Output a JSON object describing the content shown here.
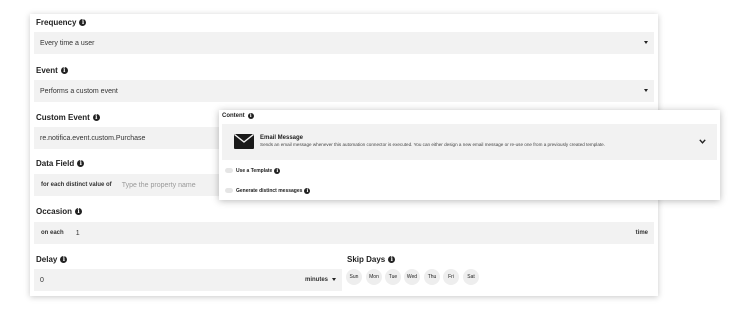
{
  "form": {
    "frequency": {
      "label": "Frequency",
      "value": "Every time a user"
    },
    "event": {
      "label": "Event",
      "value": "Performs a custom event"
    },
    "custom_event": {
      "label": "Custom Event",
      "value": "re.notifica.event.custom.Purchase"
    },
    "data_field": {
      "label": "Data Field",
      "prefix": "for each distinct value of",
      "placeholder": "Type the property name"
    },
    "occasion": {
      "label": "Occasion",
      "prefix": "on each",
      "value": "1",
      "suffix": "time"
    },
    "delay": {
      "label": "Delay",
      "value": "0",
      "unit": "minutes"
    },
    "skip_days": {
      "label": "Skip Days",
      "days": [
        "Sun",
        "Mon",
        "Tue",
        "Wed",
        "Thu",
        "Fri",
        "Sat"
      ]
    }
  },
  "content_popup": {
    "label": "Content",
    "email": {
      "title": "Email Message",
      "description": "Sends an email message whenever this automation connector is executed. You can either design a new email message or re-use one from a previously created template."
    },
    "use_template": "Use a Template",
    "distinct_messages": "Generate distinct messages"
  },
  "icons": {
    "info": "info-icon",
    "dropdown": "caret-down-icon",
    "email": "envelope-icon",
    "expand": "chevron-down-icon"
  }
}
